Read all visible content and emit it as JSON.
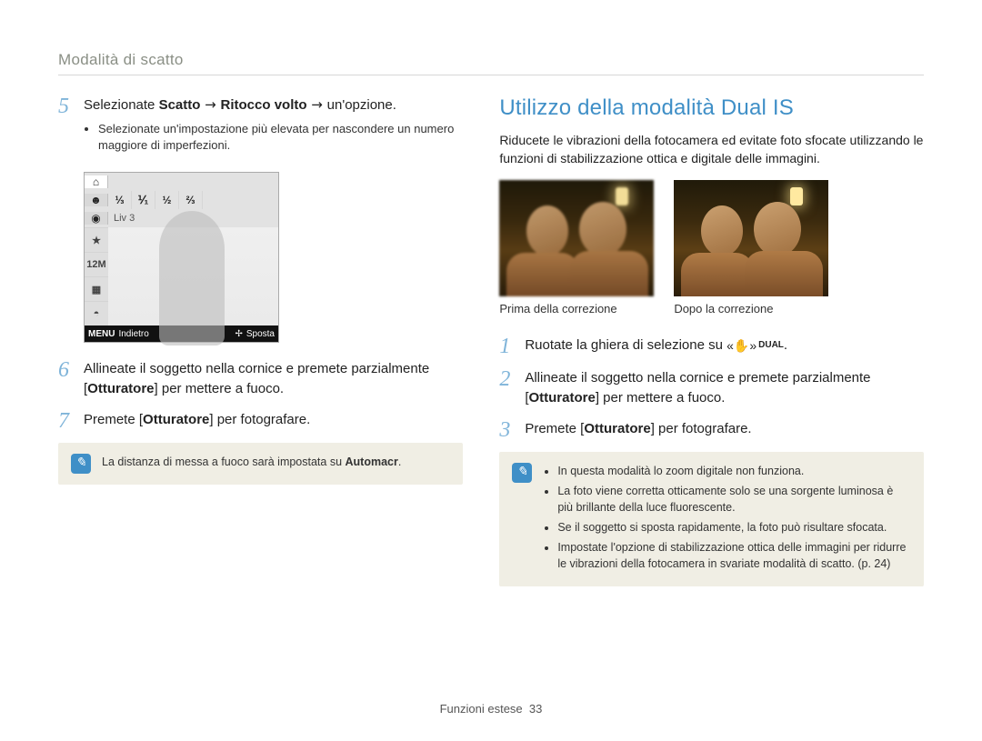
{
  "breadcrumb": "Modalità di scatto",
  "left": {
    "step5": {
      "num": "5",
      "pre": "Selezionate ",
      "b1": "Scatto",
      "arrow": " → ",
      "b2": "Ritocco volto",
      "post": " → un'opzione."
    },
    "step5_bullet": "Selezionate un'impostazione più elevata per nascondere un numero maggiore di imperfezioni.",
    "cam": {
      "opt1": "⅓",
      "opt2": "⅟₁",
      "opt3": "½",
      "opt4": "⅔",
      "liv_icon": "◉",
      "liv": "Liv 3",
      "s1": "★",
      "s2": "12M",
      "s3": "▦",
      "s4": "◓",
      "back_icon": "MENU",
      "back": "Indietro",
      "move_icon": "✢",
      "move": "Sposta"
    },
    "step6": {
      "num": "6",
      "text_a": "Allineate il soggetto nella cornice e premete parzialmente [",
      "b": "Otturatore",
      "text_b": "] per mettere a fuoco."
    },
    "step7": {
      "num": "7",
      "text_a": "Premete [",
      "b": "Otturatore",
      "text_b": "] per fotografare."
    },
    "note": {
      "text_a": "La distanza di messa a fuoco sarà impostata su ",
      "b": "Automacr",
      "text_b": "."
    }
  },
  "right": {
    "heading": "Utilizzo della modalità Dual IS",
    "intro": "Riducete le vibrazioni della fotocamera ed evitate foto sfocate utilizzando le funzioni di stabilizzazione ottica e digitale delle immagini.",
    "before_cap": "Prima della correzione",
    "after_cap": "Dopo la correzione",
    "step1": {
      "num": "1",
      "text": "Ruotate la ghiera di selezione su ",
      "dual": "DUAL",
      "dot": "."
    },
    "step2": {
      "num": "2",
      "text_a": "Allineate il soggetto nella cornice e premete parzialmente [",
      "b": "Otturatore",
      "text_b": "] per mettere a fuoco."
    },
    "step3": {
      "num": "3",
      "text_a": "Premete [",
      "b": "Otturatore",
      "text_b": "] per fotografare."
    },
    "note": {
      "b1": "In questa modalità lo zoom digitale non funziona.",
      "b2": "La foto viene corretta otticamente solo se una sorgente luminosa è più brillante della luce fluorescente.",
      "b3": "Se il soggetto si sposta rapidamente, la foto può risultare sfocata.",
      "b4": "Impostate l'opzione di stabilizzazione ottica delle immagini per ridurre le vibrazioni della fotocamera in svariate modalità di scatto. (p. 24)"
    }
  },
  "footer": {
    "section": "Funzioni estese",
    "page": "33"
  }
}
